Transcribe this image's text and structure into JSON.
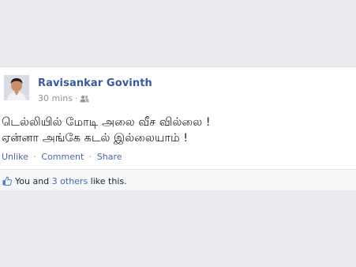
{
  "post": {
    "author": "Ravisankar Govinth",
    "time": "30 mins",
    "meta_separator": "·",
    "audience_icon": "friends-icon",
    "message_line1": "டெல்லியில் மோடி அலை வீச வில்லை !",
    "message_line2": "ஏன்னா அங்கே கடல் இல்லையாம் !",
    "actions": {
      "unlike": "Unlike",
      "comment": "Comment",
      "share": "Share",
      "separator": "·"
    }
  },
  "likes": {
    "prefix": "You and ",
    "others_link": "3 others",
    "suffix": " like this.",
    "icon": "thumbs-up-icon"
  },
  "colors": {
    "link": "#3b5998",
    "background": "#e9ebee",
    "meta": "#90949c"
  }
}
